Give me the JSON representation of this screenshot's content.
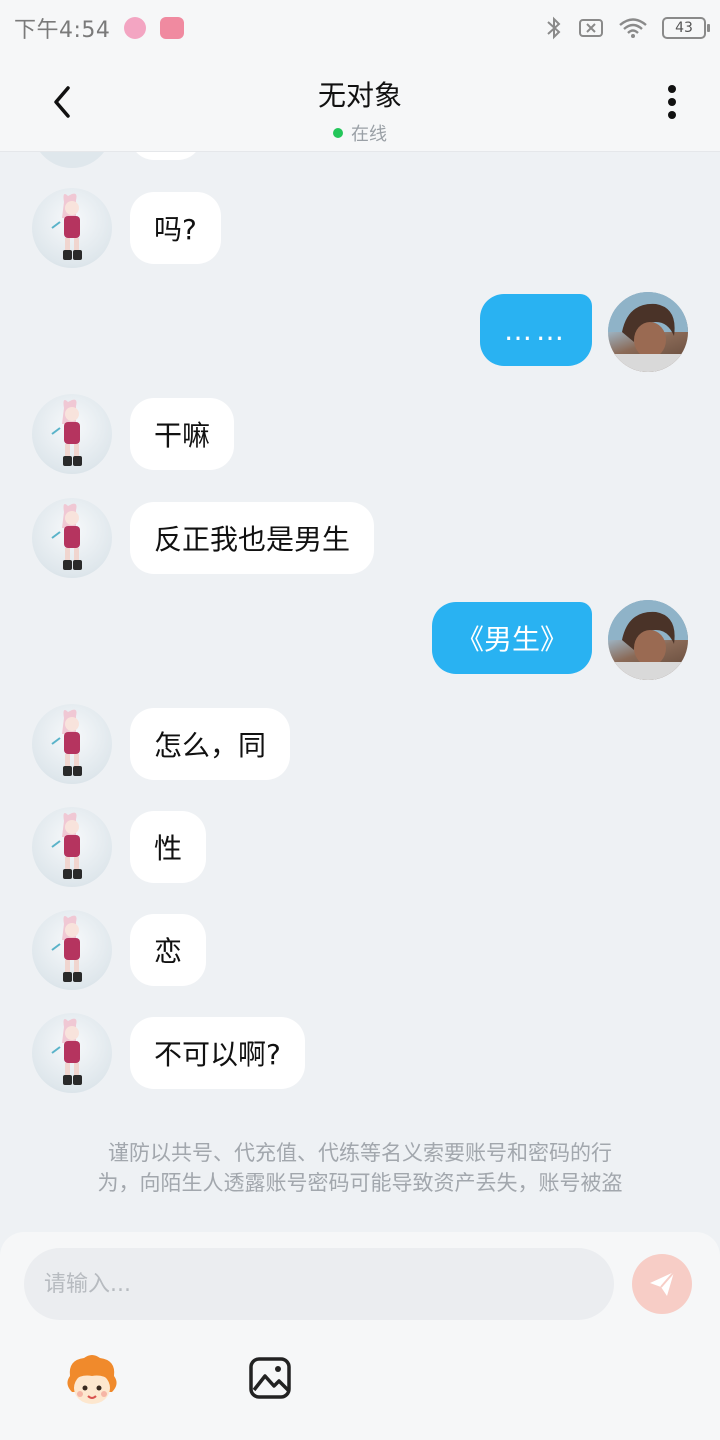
{
  "status_bar": {
    "time": "下午4:54",
    "battery": "43",
    "icons": [
      "app-icon-a",
      "app-icon-b",
      "bluetooth-icon",
      "sim-off-icon",
      "wifi-icon",
      "battery-icon"
    ]
  },
  "header": {
    "title": "无对象",
    "status": "在线",
    "status_color": "#23c65a",
    "back_icon": "chevron-left-icon",
    "menu_icon": "more-vertical-icon"
  },
  "messages": [
    {
      "from": "other",
      "text": "吗?"
    },
    {
      "from": "me",
      "text": "……"
    },
    {
      "from": "other",
      "text": "干嘛"
    },
    {
      "from": "other",
      "text": "反正我也是男生"
    },
    {
      "from": "me",
      "text": "《男生》"
    },
    {
      "from": "other",
      "text": "怎么，同"
    },
    {
      "from": "other",
      "text": "性"
    },
    {
      "from": "other",
      "text": "恋"
    },
    {
      "from": "other",
      "text": "不可以啊?"
    }
  ],
  "disclaimer": {
    "line1": "谨防以共号、代充值、代练等名义索要账号和密码的行",
    "line2": "为，向陌生人透露账号密码可能导致资产丢失，账号被盗"
  },
  "composer": {
    "placeholder": "请输入...",
    "send_icon": "paper-plane-icon",
    "emoji_icon": "mascot-emoji-icon",
    "image_icon": "image-icon"
  },
  "colors": {
    "my_bubble": "#29b2f2",
    "other_bubble": "#ffffff",
    "background": "#eef1f4",
    "send_button": "#f7cdc6"
  }
}
